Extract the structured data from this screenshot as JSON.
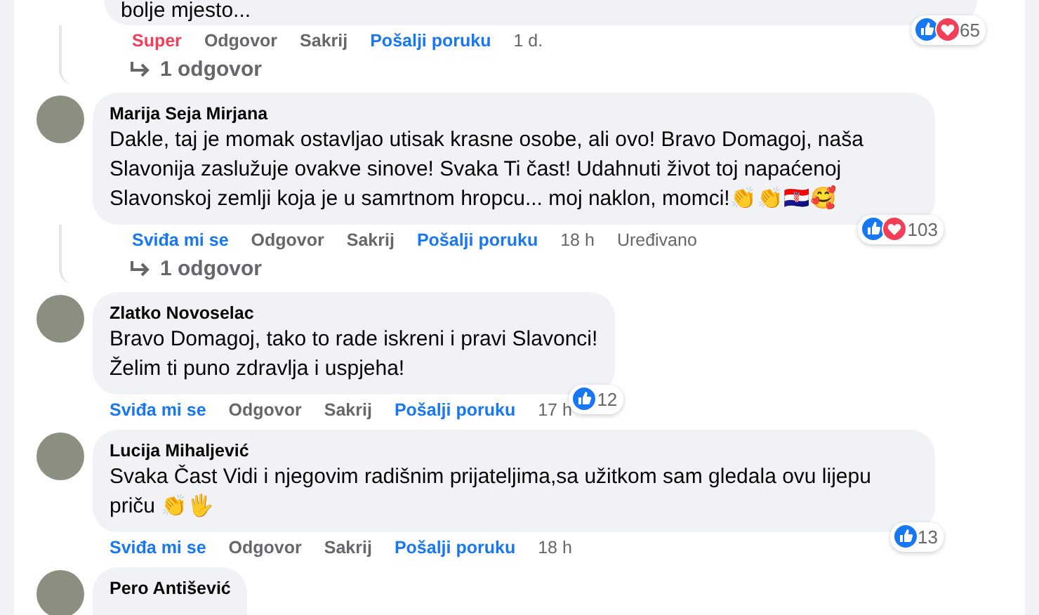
{
  "comments": [
    {
      "partial": true,
      "text": "bolje mjesto...",
      "actions": [
        {
          "kind": "love",
          "label": "Super"
        },
        {
          "kind": "reply",
          "label": "Odgovor"
        },
        {
          "kind": "hide",
          "label": "Sakrij"
        },
        {
          "kind": "message",
          "label": "Pošalji poruku"
        },
        {
          "kind": "time",
          "label": "1 d."
        }
      ],
      "reactions": {
        "icons": [
          {
            "kind": "like"
          },
          {
            "kind": "love"
          }
        ],
        "count": "65"
      },
      "replies": "1 odgovor"
    },
    {
      "author": "Marija Seja Mirjana",
      "text": "Dakle, taj je momak ostavljao utisak krasne osobe, ali ovo! Bravo Domagoj, naša Slavonija zaslužuje ovakve sinove! Svaka Ti čast! Udahnuti život toj napaćenoj Slavonskoj zemlji koja je u samrtnom hropcu... moj naklon, momci!👏👏🇭🇷🥰",
      "actions": [
        {
          "kind": "like",
          "label": "Sviđa mi se"
        },
        {
          "kind": "reply",
          "label": "Odgovor"
        },
        {
          "kind": "hide",
          "label": "Sakrij"
        },
        {
          "kind": "message",
          "label": "Pošalji poruku"
        },
        {
          "kind": "time",
          "label": "18 h"
        },
        {
          "kind": "time",
          "label": "Uređivano"
        }
      ],
      "reactions": {
        "icons": [
          {
            "kind": "like"
          },
          {
            "kind": "love"
          }
        ],
        "count": "103"
      },
      "replies": "1 odgovor"
    },
    {
      "author": "Zlatko Novoselac",
      "text": "Bravo Domagoj, tako to rade iskreni i pravi Slavonci!\nŽelim ti puno zdravlja i uspjeha!",
      "actions": [
        {
          "kind": "like",
          "label": "Sviđa mi se"
        },
        {
          "kind": "reply",
          "label": "Odgovor"
        },
        {
          "kind": "hide",
          "label": "Sakrij"
        },
        {
          "kind": "message",
          "label": "Pošalji poruku"
        },
        {
          "kind": "time",
          "label": "17 h"
        }
      ],
      "reactions": {
        "icons": [
          {
            "kind": "like"
          }
        ],
        "count": "12"
      }
    },
    {
      "author": "Lucija Mihaljević",
      "text": "Svaka Čast Vidi i njegovim radišnim prijateljima,sa užitkom sam gledala ovu lijepu priču 👏🖐",
      "actions": [
        {
          "kind": "like",
          "label": "Sviđa mi se"
        },
        {
          "kind": "reply",
          "label": "Odgovor"
        },
        {
          "kind": "hide",
          "label": "Sakrij"
        },
        {
          "kind": "message",
          "label": "Pošalji poruku"
        },
        {
          "kind": "time",
          "label": "18 h"
        }
      ],
      "reactions": {
        "icons": [
          {
            "kind": "like"
          }
        ],
        "count": "13"
      }
    },
    {
      "author": "Pero Antišević",
      "partial": true
    }
  ]
}
